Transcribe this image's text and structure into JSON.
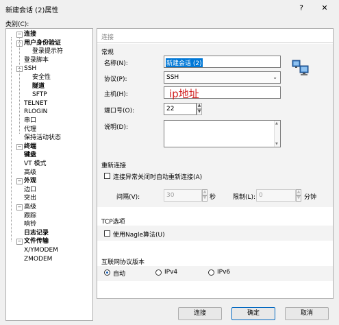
{
  "window": {
    "title": "新建会话 (2)属性",
    "help_label": "?",
    "close_label": "✕"
  },
  "category_label": "类别(C):",
  "tree": [
    {
      "label": "连接",
      "bold": true,
      "toggle": "−"
    },
    {
      "label": "用户身份验证",
      "bold": true,
      "toggle": "−"
    },
    {
      "label": "登录提示符"
    },
    {
      "label": "登录脚本"
    },
    {
      "label": "SSH",
      "toggle": "−"
    },
    {
      "label": "安全性"
    },
    {
      "label": "隧道",
      "bold": true
    },
    {
      "label": "SFTP"
    },
    {
      "label": "TELNET"
    },
    {
      "label": "RLOGIN"
    },
    {
      "label": "串口"
    },
    {
      "label": "代理"
    },
    {
      "label": "保持活动状态"
    },
    {
      "label": "终端",
      "bold": true,
      "toggle": "−"
    },
    {
      "label": "键盘",
      "bold": true
    },
    {
      "label": "VT 模式"
    },
    {
      "label": "高级"
    },
    {
      "label": "外观",
      "bold": true,
      "toggle": "−"
    },
    {
      "label": "边口"
    },
    {
      "label": "突出"
    },
    {
      "label": "高级",
      "toggle": "−"
    },
    {
      "label": "跟踪"
    },
    {
      "label": "响铃"
    },
    {
      "label": "日志记录",
      "bold": true
    },
    {
      "label": "文件传输",
      "bold": true,
      "toggle": "−"
    },
    {
      "label": "X/YMODEM"
    },
    {
      "label": "ZMODEM"
    }
  ],
  "panel": {
    "header": "连接",
    "general": {
      "section": "常规",
      "name_label": "名称(N):",
      "name_value": "新建会话 (2)",
      "protocol_label": "协议(P):",
      "protocol_value": "SSH",
      "host_label": "主机(H):",
      "host_value": "",
      "host_annotation": "ip地址",
      "port_label": "端口号(O):",
      "port_value": "22",
      "desc_label": "说明(D):",
      "desc_value": ""
    },
    "reconnect": {
      "section": "重新连接",
      "checkbox_label": "连接异常关闭时自动重新连接(A)",
      "interval_label": "间隔(V):",
      "interval_value": "30",
      "interval_unit": "秒",
      "limit_label": "限制(L):",
      "limit_value": "0",
      "limit_unit": "分钟"
    },
    "tcp": {
      "section": "TCP选项",
      "checkbox_label": "使用Nagle算法(U)"
    },
    "ipver": {
      "section": "互联网协议版本",
      "options": [
        "自动",
        "IPv4",
        "IPv6"
      ],
      "selected": "自动"
    }
  },
  "buttons": {
    "connect": "连接",
    "ok": "确定",
    "cancel": "取消"
  },
  "icons": {
    "network": "network-computers-icon",
    "dropdown": "chevron-down-icon"
  },
  "colors": {
    "annotation": "#d02020",
    "selection": "#0078d7",
    "accent": "#0067c0"
  }
}
